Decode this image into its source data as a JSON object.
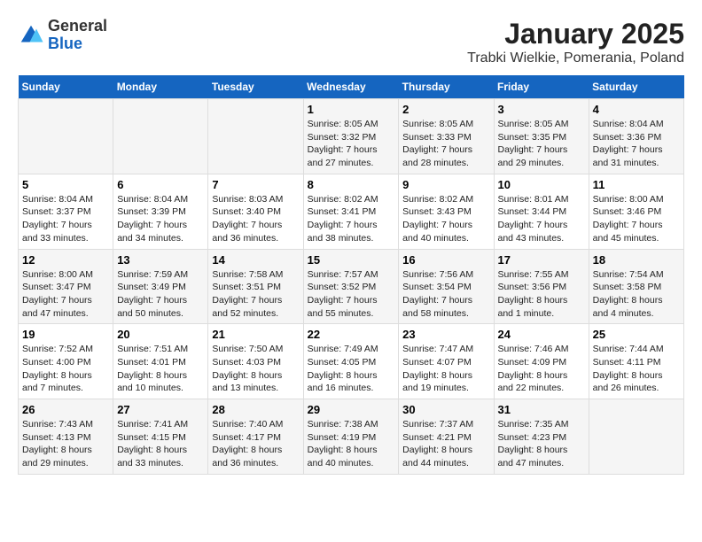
{
  "header": {
    "logo": {
      "general": "General",
      "blue": "Blue"
    },
    "title": "January 2025",
    "subtitle": "Trabki Wielkie, Pomerania, Poland"
  },
  "weekdays": [
    "Sunday",
    "Monday",
    "Tuesday",
    "Wednesday",
    "Thursday",
    "Friday",
    "Saturday"
  ],
  "weeks": [
    [
      {
        "day": "",
        "info": ""
      },
      {
        "day": "",
        "info": ""
      },
      {
        "day": "",
        "info": ""
      },
      {
        "day": "1",
        "info": "Sunrise: 8:05 AM\nSunset: 3:32 PM\nDaylight: 7 hours and 27 minutes."
      },
      {
        "day": "2",
        "info": "Sunrise: 8:05 AM\nSunset: 3:33 PM\nDaylight: 7 hours and 28 minutes."
      },
      {
        "day": "3",
        "info": "Sunrise: 8:05 AM\nSunset: 3:35 PM\nDaylight: 7 hours and 29 minutes."
      },
      {
        "day": "4",
        "info": "Sunrise: 8:04 AM\nSunset: 3:36 PM\nDaylight: 7 hours and 31 minutes."
      }
    ],
    [
      {
        "day": "5",
        "info": "Sunrise: 8:04 AM\nSunset: 3:37 PM\nDaylight: 7 hours and 33 minutes."
      },
      {
        "day": "6",
        "info": "Sunrise: 8:04 AM\nSunset: 3:39 PM\nDaylight: 7 hours and 34 minutes."
      },
      {
        "day": "7",
        "info": "Sunrise: 8:03 AM\nSunset: 3:40 PM\nDaylight: 7 hours and 36 minutes."
      },
      {
        "day": "8",
        "info": "Sunrise: 8:02 AM\nSunset: 3:41 PM\nDaylight: 7 hours and 38 minutes."
      },
      {
        "day": "9",
        "info": "Sunrise: 8:02 AM\nSunset: 3:43 PM\nDaylight: 7 hours and 40 minutes."
      },
      {
        "day": "10",
        "info": "Sunrise: 8:01 AM\nSunset: 3:44 PM\nDaylight: 7 hours and 43 minutes."
      },
      {
        "day": "11",
        "info": "Sunrise: 8:00 AM\nSunset: 3:46 PM\nDaylight: 7 hours and 45 minutes."
      }
    ],
    [
      {
        "day": "12",
        "info": "Sunrise: 8:00 AM\nSunset: 3:47 PM\nDaylight: 7 hours and 47 minutes."
      },
      {
        "day": "13",
        "info": "Sunrise: 7:59 AM\nSunset: 3:49 PM\nDaylight: 7 hours and 50 minutes."
      },
      {
        "day": "14",
        "info": "Sunrise: 7:58 AM\nSunset: 3:51 PM\nDaylight: 7 hours and 52 minutes."
      },
      {
        "day": "15",
        "info": "Sunrise: 7:57 AM\nSunset: 3:52 PM\nDaylight: 7 hours and 55 minutes."
      },
      {
        "day": "16",
        "info": "Sunrise: 7:56 AM\nSunset: 3:54 PM\nDaylight: 7 hours and 58 minutes."
      },
      {
        "day": "17",
        "info": "Sunrise: 7:55 AM\nSunset: 3:56 PM\nDaylight: 8 hours and 1 minute."
      },
      {
        "day": "18",
        "info": "Sunrise: 7:54 AM\nSunset: 3:58 PM\nDaylight: 8 hours and 4 minutes."
      }
    ],
    [
      {
        "day": "19",
        "info": "Sunrise: 7:52 AM\nSunset: 4:00 PM\nDaylight: 8 hours and 7 minutes."
      },
      {
        "day": "20",
        "info": "Sunrise: 7:51 AM\nSunset: 4:01 PM\nDaylight: 8 hours and 10 minutes."
      },
      {
        "day": "21",
        "info": "Sunrise: 7:50 AM\nSunset: 4:03 PM\nDaylight: 8 hours and 13 minutes."
      },
      {
        "day": "22",
        "info": "Sunrise: 7:49 AM\nSunset: 4:05 PM\nDaylight: 8 hours and 16 minutes."
      },
      {
        "day": "23",
        "info": "Sunrise: 7:47 AM\nSunset: 4:07 PM\nDaylight: 8 hours and 19 minutes."
      },
      {
        "day": "24",
        "info": "Sunrise: 7:46 AM\nSunset: 4:09 PM\nDaylight: 8 hours and 22 minutes."
      },
      {
        "day": "25",
        "info": "Sunrise: 7:44 AM\nSunset: 4:11 PM\nDaylight: 8 hours and 26 minutes."
      }
    ],
    [
      {
        "day": "26",
        "info": "Sunrise: 7:43 AM\nSunset: 4:13 PM\nDaylight: 8 hours and 29 minutes."
      },
      {
        "day": "27",
        "info": "Sunrise: 7:41 AM\nSunset: 4:15 PM\nDaylight: 8 hours and 33 minutes."
      },
      {
        "day": "28",
        "info": "Sunrise: 7:40 AM\nSunset: 4:17 PM\nDaylight: 8 hours and 36 minutes."
      },
      {
        "day": "29",
        "info": "Sunrise: 7:38 AM\nSunset: 4:19 PM\nDaylight: 8 hours and 40 minutes."
      },
      {
        "day": "30",
        "info": "Sunrise: 7:37 AM\nSunset: 4:21 PM\nDaylight: 8 hours and 44 minutes."
      },
      {
        "day": "31",
        "info": "Sunrise: 7:35 AM\nSunset: 4:23 PM\nDaylight: 8 hours and 47 minutes."
      },
      {
        "day": "",
        "info": ""
      }
    ]
  ]
}
